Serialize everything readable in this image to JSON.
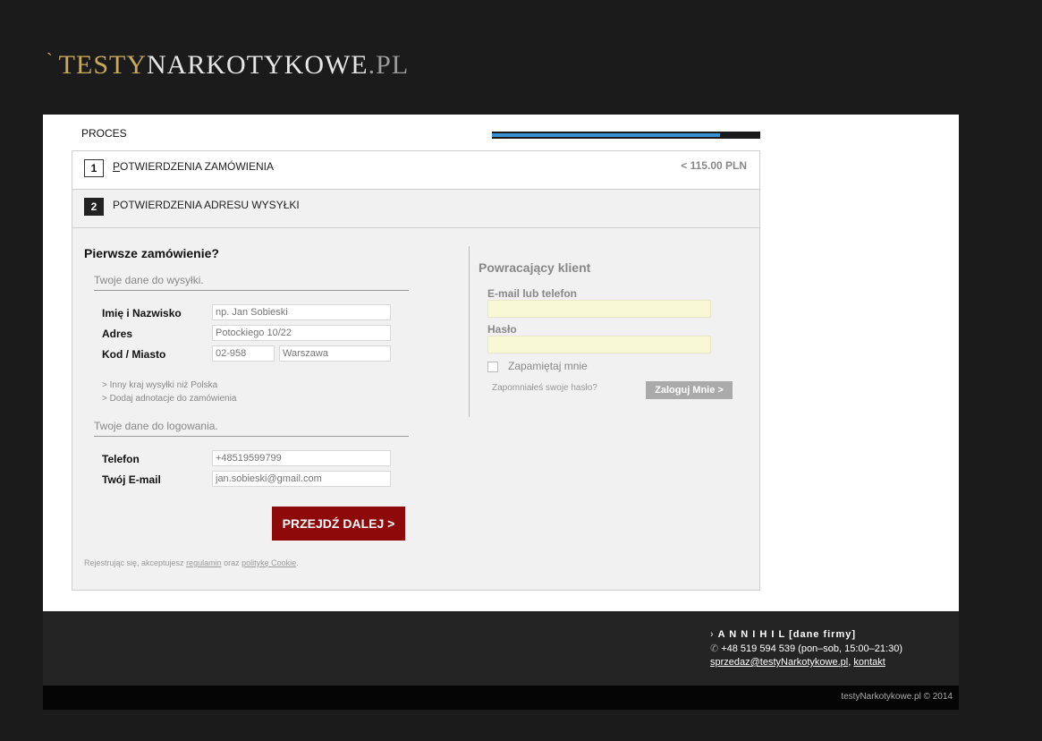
{
  "logo": {
    "tick": "`",
    "part1": "TESTY",
    "part2": "NARKOTYKOWE",
    "part3": ".PL"
  },
  "progress": {
    "label": "PROCES",
    "value_percent": 85
  },
  "steps": [
    {
      "number": "1",
      "first_letter": "P",
      "label_rest": "OTWIERDZENIA ZAMÓWIENIA",
      "price": "< 115.00 PLN"
    },
    {
      "number": "2",
      "label": "POTWIERDZENIA ADRESU WYSYŁKI"
    }
  ],
  "new_customer": {
    "heading": "Pierwsze zamówienie?",
    "shipping_section": "Twoje dane do wysyłki.",
    "fields": {
      "name": {
        "label": "Imię i Nazwisko",
        "placeholder": "np. Jan Sobieski"
      },
      "address": {
        "label": "Adres",
        "placeholder": "Potockiego 10/22"
      },
      "postal": {
        "label": "Kod / Miasto",
        "zip_placeholder": "02-958",
        "city_placeholder": "Warszawa"
      },
      "phone": {
        "label": "Telefon",
        "placeholder": "+48519599799"
      },
      "email": {
        "label": "Twój E-mail",
        "placeholder": "jan.sobieski@gmail.com"
      }
    },
    "links": {
      "other_country": "> Inny kraj wysyłki niż Polska",
      "add_note": "> Dodaj adnotacje do zamówienia"
    },
    "login_section": "Twoje dane do logowania.",
    "submit": "PRZEJDŹ DALEJ >",
    "terms": {
      "prefix": "Rejestrując się, akceptujesz ",
      "regulamin": "regulamin",
      "middle": " oraz ",
      "cookie": "politykę Cookie",
      "suffix": "."
    }
  },
  "returning": {
    "heading": "Powracający klient",
    "email_label": "E-mail lub telefon",
    "password_label": "Hasło",
    "remember": "Zapamiętaj mnie",
    "forgot": "Zapomniałeś swoje hasło?",
    "login_button": "Zaloguj Mnie >"
  },
  "footer": {
    "arrow": "›",
    "company": "A N N I H I L [dane firmy]",
    "phone_icon": "phone-icon",
    "phone": "+48 519 594 539 (pon–sob, 15:00–21:30)",
    "email": "sprzedaz@testyNarkotykowe.pl",
    "separator": ", ",
    "contact": "kontakt",
    "copyright": "testyNarkotykowe.pl © 2014"
  }
}
